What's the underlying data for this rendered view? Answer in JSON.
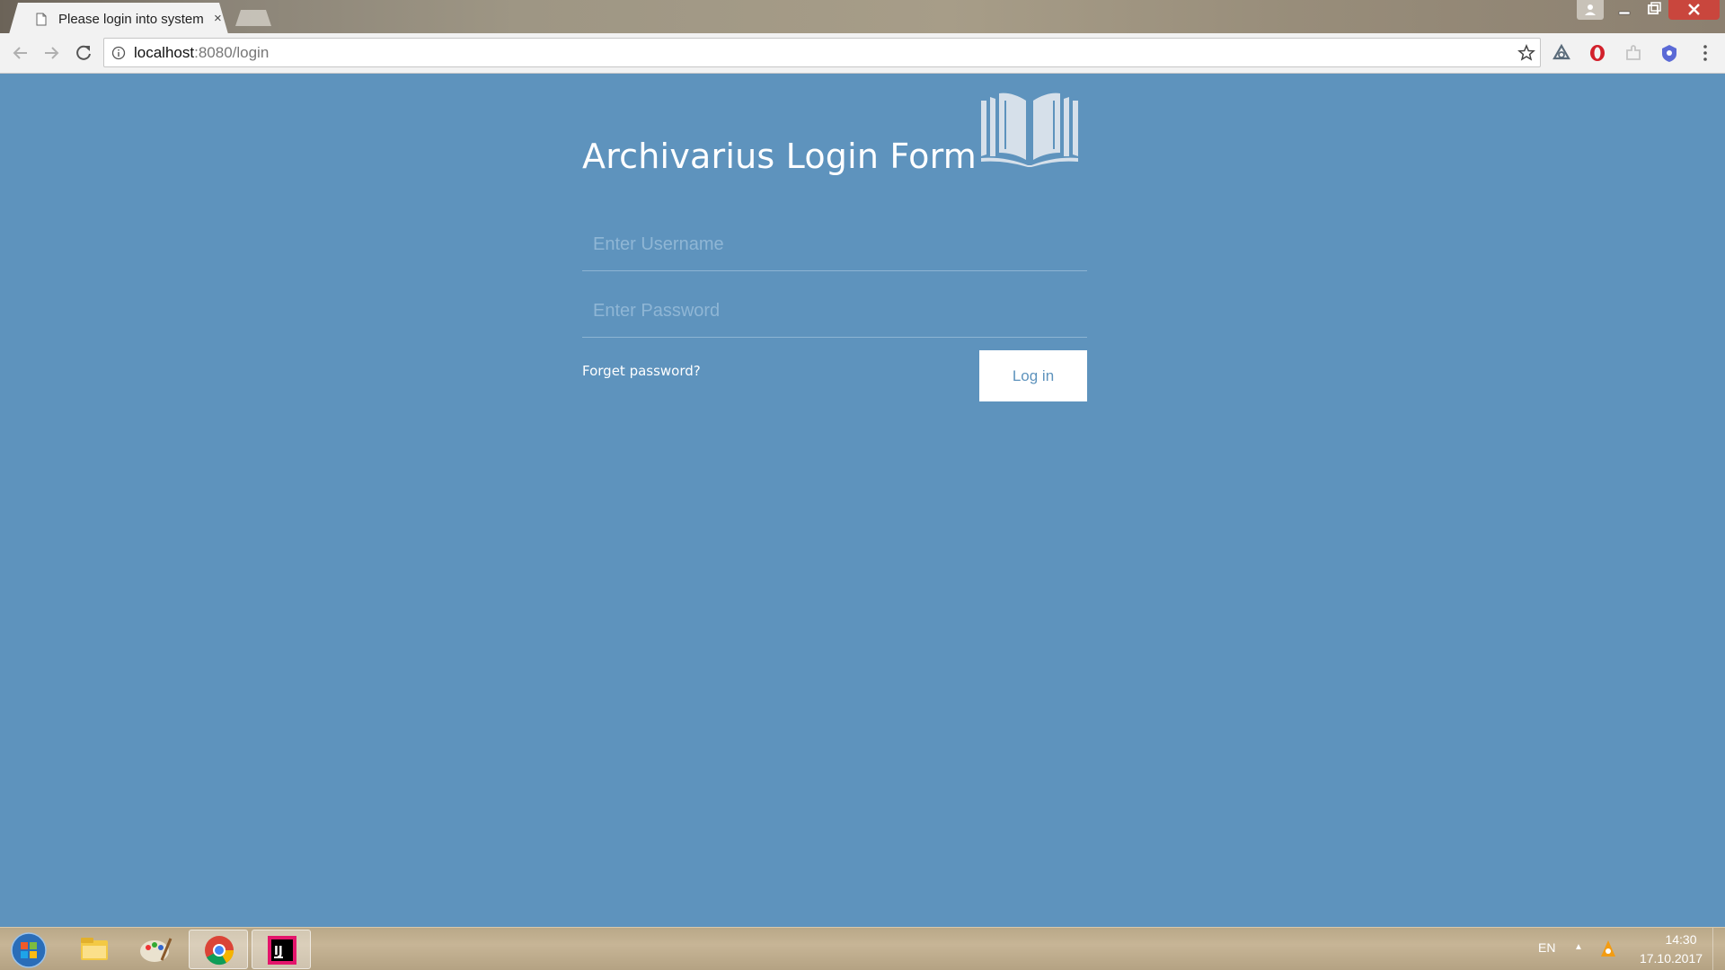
{
  "browser": {
    "tab_title": "Please login into system",
    "tab_close": "×",
    "url_host": "localhost",
    "url_rest": ":8080/login"
  },
  "page": {
    "title": "Archivarius Login Form",
    "username_placeholder": "Enter Username",
    "password_placeholder": "Enter Password",
    "forget_link": "Forget password?",
    "login_button": "Log in",
    "background_color": "#5e93bd"
  },
  "taskbar": {
    "language": "EN",
    "tray_arrow": "▲",
    "time": "14:30",
    "date": "17.10.2017",
    "apps": [
      "file-explorer-icon",
      "paint-icon",
      "chrome-icon",
      "intellij-icon"
    ]
  }
}
